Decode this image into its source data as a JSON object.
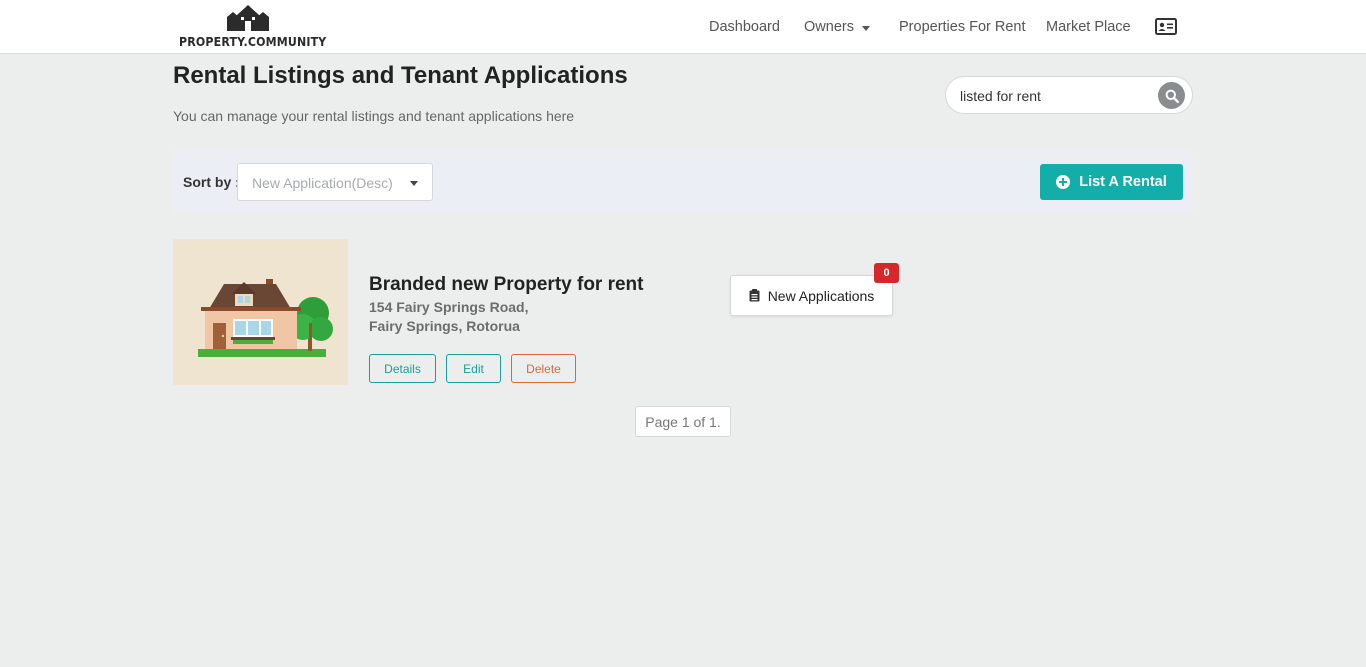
{
  "header": {
    "logo_text": "PROPERTY.COMMUNITY",
    "nav": {
      "dashboard": "Dashboard",
      "owners": "Owners",
      "properties_for_rent": "Properties For Rent",
      "market_place": "Market Place"
    },
    "profile_icon": "id-card-icon"
  },
  "page": {
    "title": "Rental Listings and Tenant Applications",
    "subtitle": "You can manage your rental listings and tenant applications here"
  },
  "search": {
    "value": "listed for rent",
    "icon": "search-icon"
  },
  "sort": {
    "label": "Sort by :",
    "selected": "New Application(Desc)"
  },
  "list_rental_button": "List A Rental",
  "listing": {
    "title": "Branded new Property for rent",
    "address_line1": "154 Fairy Springs Road,",
    "address_line2": "Fairy Springs, Rotorua",
    "buttons": {
      "details": "Details",
      "edit": "Edit",
      "delete": "Delete"
    },
    "applications_label": "New Applications",
    "applications_count": "0"
  },
  "pagination": "Page 1 of 1.",
  "colors": {
    "accent": "#13aeaa",
    "delete": "#d66a35",
    "badge": "#d6282b",
    "background": "#eceeee"
  }
}
